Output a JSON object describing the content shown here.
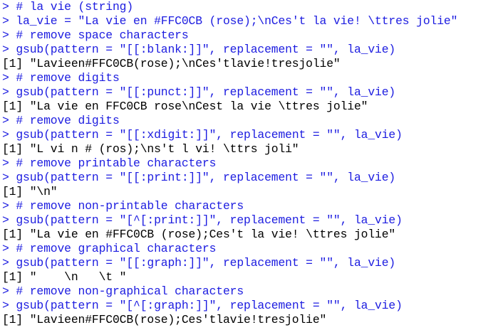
{
  "console": {
    "prompt_symbol": "> ",
    "lines": [
      {
        "kind": "input",
        "text": "# la vie (string)"
      },
      {
        "kind": "input",
        "text": "la_vie = \"La vie en #FFC0CB (rose);\\nCes't la vie! \\ttres jolie\""
      },
      {
        "kind": "input",
        "text": "# remove space characters"
      },
      {
        "kind": "input",
        "text": "gsub(pattern = \"[[:blank:]]\", replacement = \"\", la_vie)"
      },
      {
        "kind": "output",
        "text": "[1] \"Lavieen#FFC0CB(rose);\\nCes'tlavie!tresjolie\""
      },
      {
        "kind": "input",
        "text": "# remove digits"
      },
      {
        "kind": "input",
        "text": "gsub(pattern = \"[[:punct:]]\", replacement = \"\", la_vie)"
      },
      {
        "kind": "output",
        "text": "[1] \"La vie en FFC0CB rose\\nCest la vie \\ttres jolie\""
      },
      {
        "kind": "input",
        "text": "# remove digits"
      },
      {
        "kind": "input",
        "text": "gsub(pattern = \"[[:xdigit:]]\", replacement = \"\", la_vie)"
      },
      {
        "kind": "output",
        "text": "[1] \"L vi n # (ros);\\ns't l vi! \\ttrs joli\""
      },
      {
        "kind": "input",
        "text": "# remove printable characters"
      },
      {
        "kind": "input",
        "text": "gsub(pattern = \"[[:print:]]\", replacement = \"\", la_vie)"
      },
      {
        "kind": "output",
        "text": "[1] \"\\n\""
      },
      {
        "kind": "input",
        "text": "# remove non-printable characters"
      },
      {
        "kind": "input",
        "text": "gsub(pattern = \"[^[:print:]]\", replacement = \"\", la_vie)"
      },
      {
        "kind": "output",
        "text": "[1] \"La vie en #FFC0CB (rose);Ces't la vie! \\ttres jolie\""
      },
      {
        "kind": "input",
        "text": "# remove graphical characters"
      },
      {
        "kind": "input",
        "text": "gsub(pattern = \"[[:graph:]]\", replacement = \"\", la_vie)"
      },
      {
        "kind": "output",
        "text": "[1] \"    \\n   \\t \""
      },
      {
        "kind": "input",
        "text": "# remove non-graphical characters"
      },
      {
        "kind": "input",
        "text": "gsub(pattern = \"[^[:graph:]]\", replacement = \"\", la_vie)"
      },
      {
        "kind": "output",
        "text": "[1] \"Lavieen#FFC0CB(rose);Ces'tlavie!tresjolie\""
      },
      {
        "kind": "prompt",
        "text": ""
      }
    ]
  },
  "colors": {
    "input": "#1c1ce0",
    "output": "#000000",
    "background": "#ffffff"
  }
}
